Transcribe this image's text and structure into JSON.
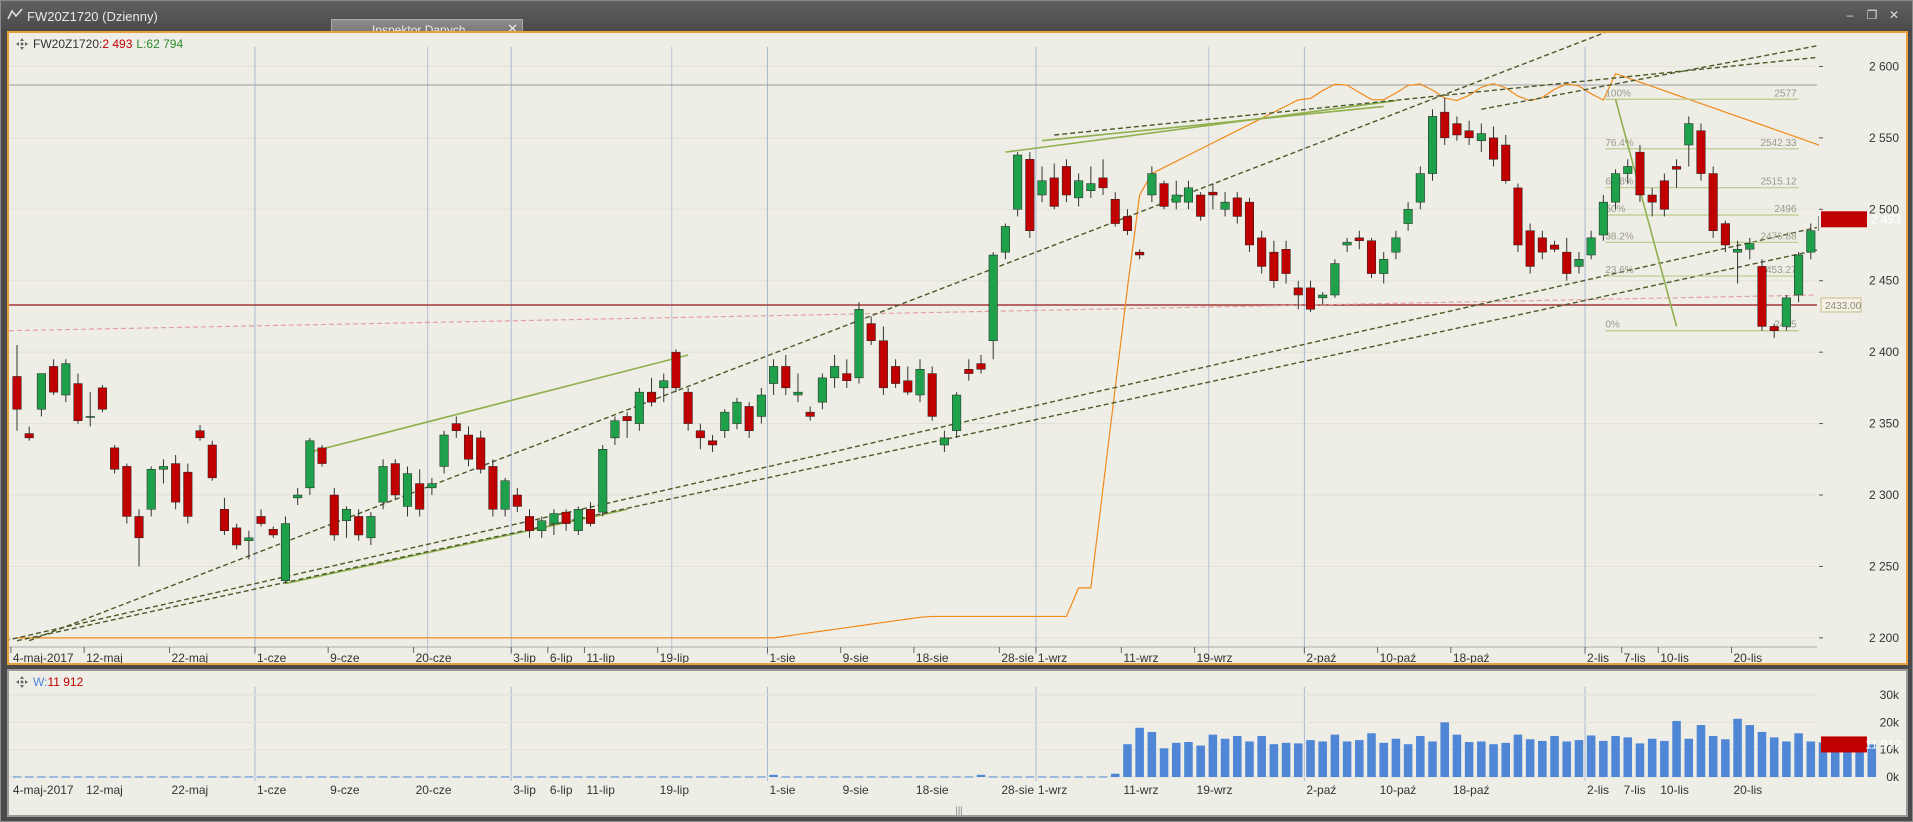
{
  "window": {
    "title": "FW20Z1720 (Dzienny)"
  },
  "inspector": {
    "label": "Inspektor Danych",
    "close": "✕"
  },
  "controls": {
    "minimize": "‒",
    "restore": "❐",
    "close": "✕"
  },
  "main_header": {
    "symbol": "FW20Z1720:",
    "price": "2 493",
    "oi_label": "L:",
    "oi_value": "62 794"
  },
  "vol_header": {
    "label": "W:",
    "value": "11 912"
  },
  "last_price_tag": "2 493",
  "last_volume_tag": "11 912",
  "h_level_tag": "2433.00",
  "colors": {
    "up": "#1fa04a",
    "down": "#c00000",
    "trend": "#8fb04e",
    "dashed": "#4a5a2a",
    "oi": "#f08a1a",
    "volume": "#4f86d6",
    "level": "#a33a3a"
  },
  "fib": [
    {
      "pct": "100%",
      "value": "2577"
    },
    {
      "pct": "76.4%",
      "value": "2542.33"
    },
    {
      "pct": "61.8%",
      "value": "2515.12"
    },
    {
      "pct": "50%",
      "value": "2496"
    },
    {
      "pct": "38.2%",
      "value": "2476.88"
    },
    {
      "pct": "23.6%",
      "value": "2453.27"
    },
    {
      "pct": "0%",
      "value": "2415"
    }
  ],
  "chart_data": [
    {
      "type": "candlestick",
      "title": "",
      "ylim": [
        2195,
        2615
      ],
      "yticks": [
        "2 200",
        "2 250",
        "2 300",
        "2 350",
        "2 400",
        "2 450",
        "2 500",
        "2 550",
        "2 600"
      ],
      "yticks_values": [
        2200,
        2250,
        2300,
        2350,
        2400,
        2450,
        2500,
        2550,
        2600
      ],
      "xlabels": [
        {
          "i": 0,
          "label": "4-maj-2017"
        },
        {
          "i": 6,
          "label": "12-maj"
        },
        {
          "i": 13,
          "label": "22-maj"
        },
        {
          "i": 20,
          "label": "1-cze"
        },
        {
          "i": 26,
          "label": "9-cze"
        },
        {
          "i": 33,
          "label": "20-cze"
        },
        {
          "i": 41,
          "label": "3-lip"
        },
        {
          "i": 44,
          "label": "6-lip"
        },
        {
          "i": 47,
          "label": "11-lip"
        },
        {
          "i": 53,
          "label": "19-lip"
        },
        {
          "i": 62,
          "label": "1-sie"
        },
        {
          "i": 68,
          "label": "9-sie"
        },
        {
          "i": 74,
          "label": "18-sie"
        },
        {
          "i": 81,
          "label": "28-sie"
        },
        {
          "i": 84,
          "label": "1-wrz"
        },
        {
          "i": 91,
          "label": "11-wrz"
        },
        {
          "i": 97,
          "label": "19-wrz"
        },
        {
          "i": 106,
          "label": "2-paź"
        },
        {
          "i": 112,
          "label": "10-paź"
        },
        {
          "i": 118,
          "label": "18-paź"
        },
        {
          "i": 129,
          "label": "2-lis"
        },
        {
          "i": 132,
          "label": "7-lis"
        },
        {
          "i": 135,
          "label": "10-lis"
        },
        {
          "i": 141,
          "label": "20-lis"
        }
      ],
      "candles": [
        [
          2383,
          2405,
          2345,
          2360
        ],
        [
          2343,
          2348,
          2338,
          2340
        ],
        [
          2360,
          2385,
          2355,
          2385
        ],
        [
          2390,
          2395,
          2370,
          2372
        ],
        [
          2370,
          2395,
          2365,
          2392
        ],
        [
          2378,
          2385,
          2350,
          2352
        ],
        [
          2355,
          2372,
          2348,
          2355
        ],
        [
          2375,
          2377,
          2358,
          2360
        ],
        [
          2333,
          2335,
          2315,
          2318
        ],
        [
          2320,
          2322,
          2280,
          2285
        ],
        [
          2285,
          2290,
          2250,
          2270
        ],
        [
          2290,
          2320,
          2285,
          2318
        ],
        [
          2318,
          2325,
          2308,
          2320
        ],
        [
          2322,
          2328,
          2290,
          2295
        ],
        [
          2316,
          2322,
          2280,
          2285
        ],
        [
          2345,
          2349,
          2338,
          2340
        ],
        [
          2335,
          2338,
          2310,
          2312
        ],
        [
          2290,
          2298,
          2272,
          2275
        ],
        [
          2277,
          2280,
          2262,
          2265
        ],
        [
          2268,
          2275,
          2255,
          2270
        ],
        [
          2285,
          2290,
          2278,
          2280
        ],
        [
          2276,
          2278,
          2270,
          2272
        ],
        [
          2240,
          2285,
          2238,
          2280
        ],
        [
          2298,
          2305,
          2293,
          2300
        ],
        [
          2305,
          2340,
          2300,
          2338
        ],
        [
          2333,
          2335,
          2320,
          2322
        ],
        [
          2300,
          2305,
          2268,
          2272
        ],
        [
          2282,
          2292,
          2270,
          2290
        ],
        [
          2285,
          2290,
          2268,
          2272
        ],
        [
          2270,
          2288,
          2265,
          2285
        ],
        [
          2295,
          2325,
          2290,
          2320
        ],
        [
          2322,
          2325,
          2297,
          2300
        ],
        [
          2292,
          2320,
          2285,
          2315
        ],
        [
          2308,
          2318,
          2285,
          2290
        ],
        [
          2305,
          2312,
          2300,
          2308
        ],
        [
          2320,
          2345,
          2315,
          2342
        ],
        [
          2350,
          2355,
          2340,
          2345
        ],
        [
          2342,
          2348,
          2320,
          2325
        ],
        [
          2340,
          2345,
          2315,
          2318
        ],
        [
          2320,
          2325,
          2285,
          2290
        ],
        [
          2290,
          2312,
          2285,
          2310
        ],
        [
          2300,
          2305,
          2288,
          2292
        ],
        [
          2285,
          2290,
          2270,
          2275
        ],
        [
          2275,
          2285,
          2270,
          2282
        ],
        [
          2280,
          2290,
          2272,
          2287
        ],
        [
          2288,
          2290,
          2275,
          2280
        ],
        [
          2275,
          2292,
          2272,
          2290
        ],
        [
          2290,
          2295,
          2278,
          2280
        ],
        [
          2288,
          2335,
          2285,
          2332
        ],
        [
          2340,
          2355,
          2335,
          2352
        ],
        [
          2355,
          2358,
          2340,
          2352
        ],
        [
          2350,
          2375,
          2345,
          2372
        ],
        [
          2372,
          2382,
          2362,
          2365
        ],
        [
          2375,
          2385,
          2365,
          2380
        ],
        [
          2400,
          2402,
          2372,
          2375
        ],
        [
          2372,
          2375,
          2345,
          2350
        ],
        [
          2345,
          2350,
          2332,
          2340
        ],
        [
          2338,
          2342,
          2330,
          2335
        ],
        [
          2345,
          2360,
          2340,
          2358
        ],
        [
          2350,
          2368,
          2346,
          2365
        ],
        [
          2362,
          2365,
          2340,
          2345
        ],
        [
          2355,
          2375,
          2350,
          2370
        ],
        [
          2378,
          2395,
          2370,
          2390
        ],
        [
          2390,
          2398,
          2370,
          2375
        ],
        [
          2370,
          2385,
          2365,
          2372
        ],
        [
          2358,
          2362,
          2352,
          2355
        ],
        [
          2365,
          2385,
          2360,
          2382
        ],
        [
          2382,
          2398,
          2375,
          2390
        ],
        [
          2385,
          2395,
          2375,
          2380
        ],
        [
          2382,
          2435,
          2378,
          2430
        ],
        [
          2420,
          2425,
          2405,
          2408
        ],
        [
          2408,
          2418,
          2370,
          2375
        ],
        [
          2390,
          2395,
          2375,
          2378
        ],
        [
          2380,
          2390,
          2370,
          2372
        ],
        [
          2370,
          2395,
          2365,
          2388
        ],
        [
          2385,
          2390,
          2352,
          2355
        ],
        [
          2335,
          2345,
          2330,
          2340
        ],
        [
          2345,
          2372,
          2340,
          2370
        ],
        [
          2388,
          2395,
          2380,
          2385
        ],
        [
          2392,
          2398,
          2385,
          2388
        ],
        [
          2408,
          2470,
          2395,
          2468
        ],
        [
          2470,
          2490,
          2465,
          2488
        ],
        [
          2500,
          2540,
          2495,
          2538
        ],
        [
          2535,
          2540,
          2480,
          2485
        ],
        [
          2510,
          2530,
          2505,
          2520
        ],
        [
          2522,
          2532,
          2500,
          2502
        ],
        [
          2530,
          2535,
          2505,
          2510
        ],
        [
          2508,
          2525,
          2502,
          2520
        ],
        [
          2513,
          2530,
          2508,
          2518
        ],
        [
          2522,
          2535,
          2510,
          2515
        ],
        [
          2507,
          2512,
          2488,
          2490
        ],
        [
          2495,
          2500,
          2482,
          2485
        ],
        [
          2470,
          2472,
          2465,
          2468
        ],
        [
          2510,
          2530,
          2505,
          2525
        ],
        [
          2518,
          2520,
          2500,
          2502
        ],
        [
          2505,
          2520,
          2500,
          2510
        ],
        [
          2505,
          2520,
          2500,
          2515
        ],
        [
          2510,
          2512,
          2492,
          2495
        ],
        [
          2512,
          2518,
          2500,
          2510
        ],
        [
          2500,
          2512,
          2495,
          2505
        ],
        [
          2508,
          2512,
          2490,
          2495
        ],
        [
          2505,
          2508,
          2470,
          2475
        ],
        [
          2480,
          2485,
          2455,
          2460
        ],
        [
          2470,
          2478,
          2445,
          2450
        ],
        [
          2472,
          2478,
          2448,
          2455
        ],
        [
          2445,
          2450,
          2430,
          2440
        ],
        [
          2445,
          2450,
          2428,
          2430
        ],
        [
          2438,
          2442,
          2433,
          2440
        ],
        [
          2440,
          2465,
          2438,
          2462
        ],
        [
          2475,
          2480,
          2470,
          2477
        ],
        [
          2480,
          2485,
          2472,
          2478
        ],
        [
          2478,
          2480,
          2452,
          2455
        ],
        [
          2455,
          2470,
          2448,
          2465
        ],
        [
          2470,
          2485,
          2465,
          2480
        ],
        [
          2490,
          2505,
          2485,
          2500
        ],
        [
          2505,
          2530,
          2500,
          2525
        ],
        [
          2525,
          2570,
          2520,
          2565
        ],
        [
          2568,
          2578,
          2545,
          2550
        ],
        [
          2560,
          2565,
          2548,
          2552
        ],
        [
          2555,
          2562,
          2545,
          2550
        ],
        [
          2548,
          2560,
          2540,
          2553
        ],
        [
          2550,
          2558,
          2530,
          2535
        ],
        [
          2545,
          2552,
          2518,
          2520
        ],
        [
          2515,
          2518,
          2470,
          2475
        ],
        [
          2485,
          2490,
          2455,
          2460
        ],
        [
          2480,
          2485,
          2465,
          2470
        ],
        [
          2475,
          2478,
          2470,
          2472
        ],
        [
          2470,
          2480,
          2450,
          2455
        ],
        [
          2460,
          2470,
          2455,
          2465
        ],
        [
          2468,
          2485,
          2465,
          2480
        ],
        [
          2482,
          2510,
          2478,
          2505
        ],
        [
          2505,
          2528,
          2500,
          2525
        ],
        [
          2525,
          2535,
          2518,
          2530
        ],
        [
          2540,
          2545,
          2505,
          2510
        ],
        [
          2510,
          2515,
          2495,
          2505
        ],
        [
          2520,
          2525,
          2495,
          2500
        ],
        [
          2530,
          2535,
          2515,
          2528
        ],
        [
          2545,
          2565,
          2530,
          2560
        ],
        [
          2555,
          2560,
          2520,
          2525
        ],
        [
          2525,
          2530,
          2480,
          2485
        ],
        [
          2490,
          2492,
          2470,
          2475
        ],
        [
          2470,
          2478,
          2448,
          2472
        ],
        [
          2472,
          2480,
          2465,
          2476
        ],
        [
          2460,
          2465,
          2415,
          2418
        ],
        [
          2418,
          2420,
          2410,
          2415
        ],
        [
          2418,
          2440,
          2415,
          2438
        ],
        [
          2440,
          2470,
          2435,
          2468
        ],
        [
          2470,
          2490,
          2465,
          2485
        ],
        [
          2485,
          2500,
          2480,
          2495
        ],
        [
          2490,
          2495,
          2475,
          2480
        ],
        [
          2490,
          2515,
          2485,
          2510
        ],
        [
          2515,
          2520,
          2485,
          2490
        ],
        [
          2478,
          2510,
          2472,
          2505
        ],
        [
          2495,
          2500,
          2490,
          2493
        ]
      ]
    },
    {
      "type": "bar",
      "title": "",
      "ylim": [
        0,
        30000
      ],
      "yticks": [
        "0k",
        "10k",
        "20k",
        "30k"
      ],
      "yticks_values": [
        0,
        10000,
        20000,
        30000
      ],
      "series": [
        {
          "name": "W",
          "values": [
            200,
            200,
            200,
            200,
            200,
            200,
            200,
            200,
            200,
            200,
            200,
            200,
            200,
            200,
            200,
            200,
            200,
            200,
            200,
            200,
            200,
            200,
            200,
            200,
            200,
            200,
            200,
            200,
            200,
            200,
            200,
            200,
            200,
            200,
            200,
            200,
            200,
            200,
            200,
            200,
            200,
            200,
            200,
            200,
            200,
            200,
            200,
            200,
            200,
            200,
            200,
            200,
            200,
            200,
            200,
            200,
            200,
            200,
            200,
            200,
            200,
            200,
            800,
            200,
            200,
            200,
            200,
            200,
            200,
            200,
            200,
            200,
            200,
            200,
            200,
            200,
            200,
            200,
            200,
            800,
            200,
            200,
            200,
            200,
            200,
            200,
            200,
            200,
            200,
            200,
            1200,
            12000,
            18000,
            16500,
            10500,
            12500,
            12800,
            11500,
            15500,
            14000,
            15000,
            13000,
            15000,
            12000,
            12500,
            12300,
            13500,
            13000,
            15500,
            13000,
            13500,
            16000,
            12500,
            14000,
            12000,
            15000,
            13000,
            20000,
            15500,
            12800,
            13000,
            12000,
            12500,
            15500,
            13800,
            13200,
            15000,
            13000,
            13500,
            15200,
            13200,
            15000,
            14500,
            12300,
            14000,
            13200,
            20500,
            14000,
            19000,
            15000,
            13800,
            21300,
            19000,
            16500,
            14500,
            13000,
            16000,
            13000,
            12700,
            13300,
            12800,
            13200,
            11912
          ]
        }
      ]
    }
  ]
}
